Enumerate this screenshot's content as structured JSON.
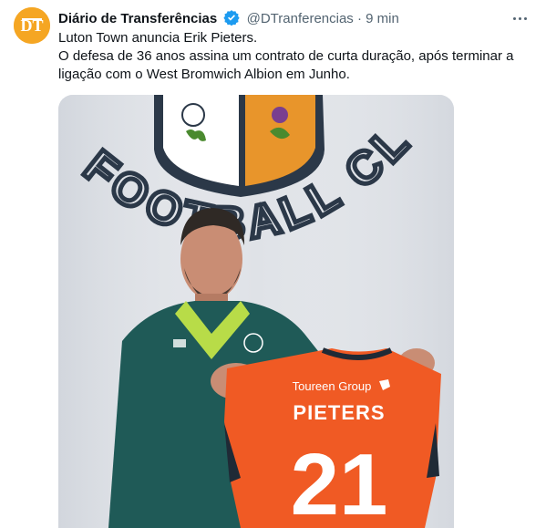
{
  "account": {
    "name": "Diário de Transferências",
    "handle": "@DTranferencias",
    "separator": "·",
    "time": "9 min",
    "avatar_icon": "dt-logo-icon",
    "verified_icon": "verified-badge-icon"
  },
  "tweet": {
    "lines": [
      "Luton Town anuncia Erik Pieters.",
      "O defesa de 36 anos assina um contrato de curta duração, após terminar a",
      "ligação com o West Bromwich Albion em Junho."
    ]
  },
  "media": {
    "wall_text": "FOOTBALL CLUB",
    "shirt_sponsor": "Toureen Group",
    "shirt_name": "PIETERS",
    "shirt_number": "21",
    "colors": {
      "wall": "#dfe2e7",
      "wall_letters": "#2b3848",
      "shirt": "#f05a24",
      "jacket": "#1f5a57",
      "collar": "#b8dc48"
    }
  },
  "colors": {
    "text": "#0f1419",
    "muted": "#536471",
    "verified": "#1d9bf0",
    "avatar": "#f5a623"
  }
}
